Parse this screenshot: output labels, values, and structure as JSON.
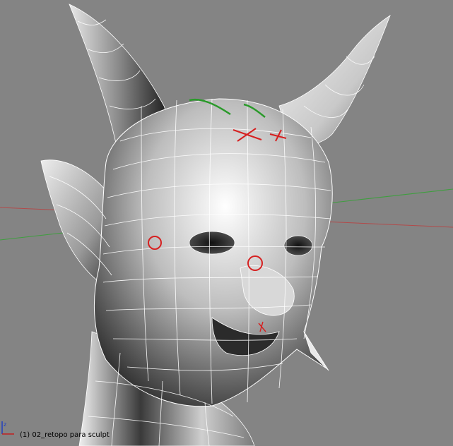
{
  "viewport": {
    "object_label": "(1) 02_retopo para sculpt",
    "background_color": "#848484",
    "mesh_fill_color": "#c8c8c8",
    "wire_color": "#ffffff",
    "grid_x_axis_color": "#b24a4a",
    "grid_y_axis_color": "#3f9e3f",
    "annotation_red_color": "#d62020",
    "annotation_green_color": "#2a9a2a"
  },
  "axis_gizmo": {
    "icon": "xyz-axis-gizmo-icon",
    "x_color": "#c02020",
    "z_color": "#2040c0"
  },
  "model": {
    "description_icon": "horned-demon-head-mesh"
  }
}
